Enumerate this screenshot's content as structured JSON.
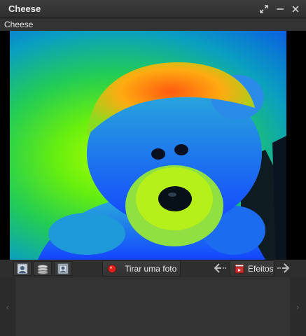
{
  "window": {
    "title": "Cheese"
  },
  "menubar": {
    "app_menu_label": "Cheese"
  },
  "toolbar": {
    "photo_mode_tooltip_icon": "camera-photo-icon",
    "video_mode_icon": "camera-video-icon",
    "burst_mode_icon": "camera-burst-icon",
    "take_photo_label": "Tirar uma foto",
    "effects_label": "Efeitos"
  },
  "colors": {
    "window_bg": "#2b2b2b",
    "titlebar_bg": "#353535",
    "record_red": "#e02020"
  }
}
